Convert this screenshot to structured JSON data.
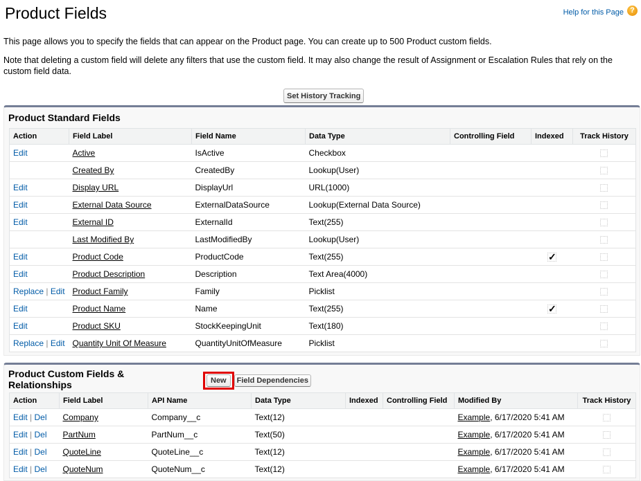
{
  "header": {
    "title": "Product Fields",
    "help_link": "Help for this Page",
    "help_icon": "?"
  },
  "intro": "This page allows you to specify the fields that can appear on the Product page. You can create up to 500 Product custom fields.",
  "note": "Note that deleting a custom field will delete any filters that use the custom field. It may also change the result of Assignment or Escalation Rules that rely on the custom field data.",
  "history_button": "Set History Tracking",
  "standard": {
    "title": "Product Standard Fields",
    "columns": [
      "Action",
      "Field Label",
      "Field Name",
      "Data Type",
      "Controlling Field",
      "Indexed",
      "Track History"
    ],
    "rows": [
      {
        "replace": "",
        "edit": "Edit",
        "label": "Active",
        "name": "IsActive",
        "type": "Checkbox",
        "controlling": "",
        "indexed": false
      },
      {
        "replace": "",
        "edit": "",
        "label": "Created By",
        "name": "CreatedBy",
        "type": "Lookup(User)",
        "controlling": "",
        "indexed": false
      },
      {
        "replace": "",
        "edit": "Edit",
        "label": "Display URL",
        "name": "DisplayUrl",
        "type": "URL(1000)",
        "controlling": "",
        "indexed": false
      },
      {
        "replace": "",
        "edit": "Edit",
        "label": "External Data Source",
        "name": "ExternalDataSource",
        "type": "Lookup(External Data Source)",
        "controlling": "",
        "indexed": false
      },
      {
        "replace": "",
        "edit": "Edit",
        "label": "External ID",
        "name": "ExternalId",
        "type": "Text(255)",
        "controlling": "",
        "indexed": false
      },
      {
        "replace": "",
        "edit": "",
        "label": "Last Modified By",
        "name": "LastModifiedBy",
        "type": "Lookup(User)",
        "controlling": "",
        "indexed": false
      },
      {
        "replace": "",
        "edit": "Edit",
        "label": "Product Code",
        "name": "ProductCode",
        "type": "Text(255)",
        "controlling": "",
        "indexed": true
      },
      {
        "replace": "",
        "edit": "Edit",
        "label": "Product Description",
        "name": "Description",
        "type": "Text Area(4000)",
        "controlling": "",
        "indexed": false
      },
      {
        "replace": "Replace",
        "edit": "Edit",
        "label": "Product Family",
        "name": "Family",
        "type": "Picklist",
        "controlling": "",
        "indexed": false
      },
      {
        "replace": "",
        "edit": "Edit",
        "label": "Product Name",
        "name": "Name",
        "type": "Text(255)",
        "controlling": "",
        "indexed": true
      },
      {
        "replace": "",
        "edit": "Edit",
        "label": "Product SKU",
        "name": "StockKeepingUnit",
        "type": "Text(180)",
        "controlling": "",
        "indexed": false
      },
      {
        "replace": "Replace",
        "edit": "Edit",
        "label": "Quantity Unit Of Measure",
        "name": "QuantityUnitOfMeasure",
        "type": "Picklist",
        "controlling": "",
        "indexed": false
      }
    ]
  },
  "custom": {
    "title": "Product Custom Fields & Relationships",
    "new_button": "New",
    "dependencies_button": "Field Dependencies",
    "columns": [
      "Action",
      "Field Label",
      "API Name",
      "Data Type",
      "Indexed",
      "Controlling Field",
      "Modified By",
      "Track History"
    ],
    "rows": [
      {
        "edit": "Edit",
        "del": "Del",
        "label": "Company",
        "api": "Company__c",
        "type": "Text(12)",
        "indexed": "",
        "controlling": "",
        "modified_user": "Example",
        "modified_date": ", 6/17/2020 5:41 AM"
      },
      {
        "edit": "Edit",
        "del": "Del",
        "label": "PartNum",
        "api": "PartNum__c",
        "type": "Text(50)",
        "indexed": "",
        "controlling": "",
        "modified_user": "Example",
        "modified_date": ", 6/17/2020 5:41 AM"
      },
      {
        "edit": "Edit",
        "del": "Del",
        "label": "QuoteLine",
        "api": "QuoteLine__c",
        "type": "Text(12)",
        "indexed": "",
        "controlling": "",
        "modified_user": "Example",
        "modified_date": ", 6/17/2020 5:41 AM"
      },
      {
        "edit": "Edit",
        "del": "Del",
        "label": "QuoteNum",
        "api": "QuoteNum__c",
        "type": "Text(12)",
        "indexed": "",
        "controlling": "",
        "modified_user": "Example",
        "modified_date": ", 6/17/2020 5:41 AM"
      }
    ]
  },
  "icons": {
    "check": "✓"
  }
}
